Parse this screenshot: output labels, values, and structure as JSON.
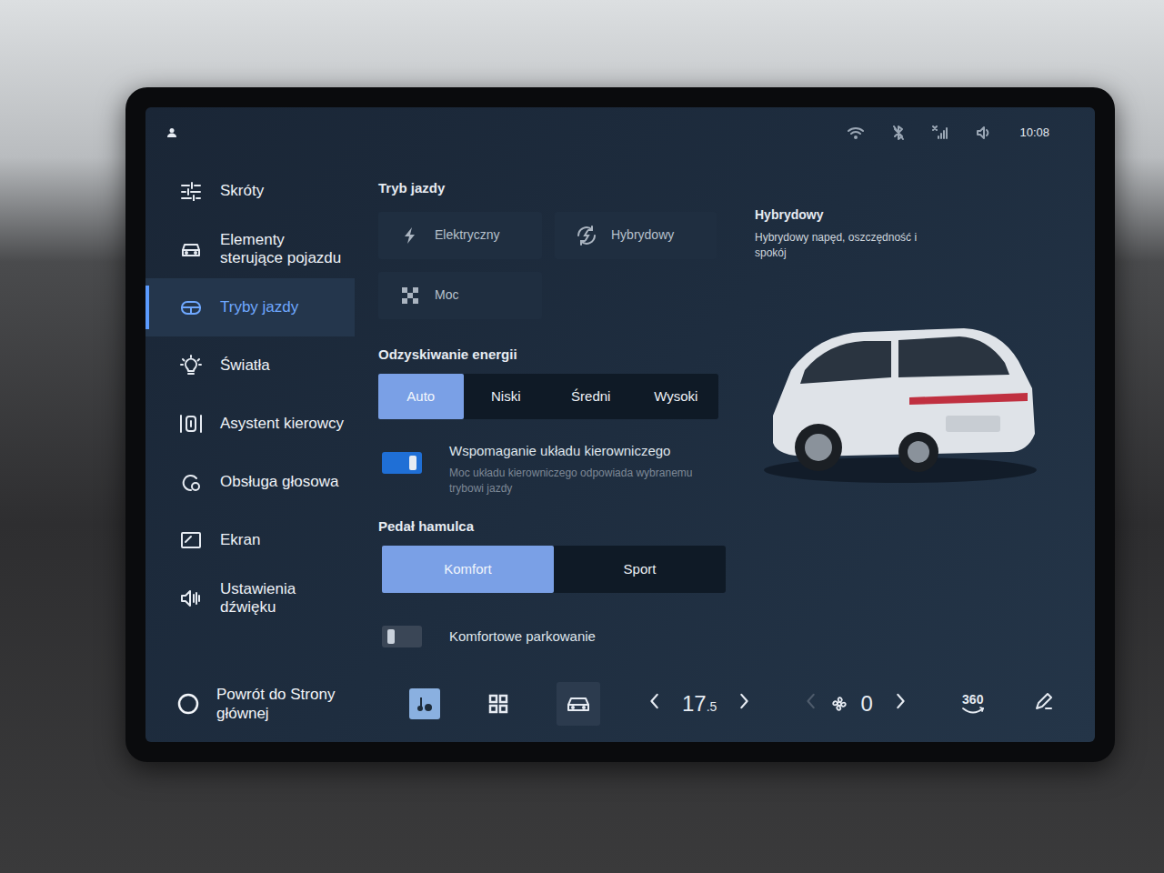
{
  "status_bar": {
    "time": "10:08"
  },
  "sidebar": {
    "items": [
      {
        "label": "Skróty",
        "selected": false
      },
      {
        "label": "Elementy sterujące pojazdu",
        "selected": false
      },
      {
        "label": "Tryby jazdy",
        "selected": true
      },
      {
        "label": "Światła",
        "selected": false
      },
      {
        "label": "Asystent kierowcy",
        "selected": false
      },
      {
        "label": "Obsługa głosowa",
        "selected": false
      },
      {
        "label": "Ekran",
        "selected": false
      },
      {
        "label": "Ustawienia dźwięku",
        "selected": false
      }
    ],
    "home": "Powrót do Strony głównej"
  },
  "drive_mode": {
    "title": "Tryb jazdy",
    "modes": [
      {
        "label": "Elektryczny"
      },
      {
        "label": "Hybrydowy"
      },
      {
        "label": "Moc"
      }
    ],
    "info": {
      "title": "Hybrydowy",
      "text": "Hybrydowy napęd, oszczędność i spokój"
    }
  },
  "energy_recovery": {
    "title": "Odzyskiwanie energii",
    "options": [
      {
        "label": "Auto",
        "selected": true
      },
      {
        "label": "Niski",
        "selected": false
      },
      {
        "label": "Średni",
        "selected": false
      },
      {
        "label": "Wysoki",
        "selected": false
      }
    ]
  },
  "steering_assist": {
    "label": "Wspomaganie układu kierowniczego",
    "description": "Moc układu kierowniczego odpowiada wybranemu trybowi jazdy",
    "on": true
  },
  "brake_pedal": {
    "title": "Pedał hamulca",
    "options": [
      {
        "label": "Komfort",
        "selected": true
      },
      {
        "label": "Sport",
        "selected": false
      }
    ]
  },
  "comfort_parking": {
    "label": "Komfortowe parkowanie",
    "on": false
  },
  "bottom_bar": {
    "temperature": "17",
    "temperature_decimal": ".5",
    "fan": "0",
    "camera": "360"
  }
}
